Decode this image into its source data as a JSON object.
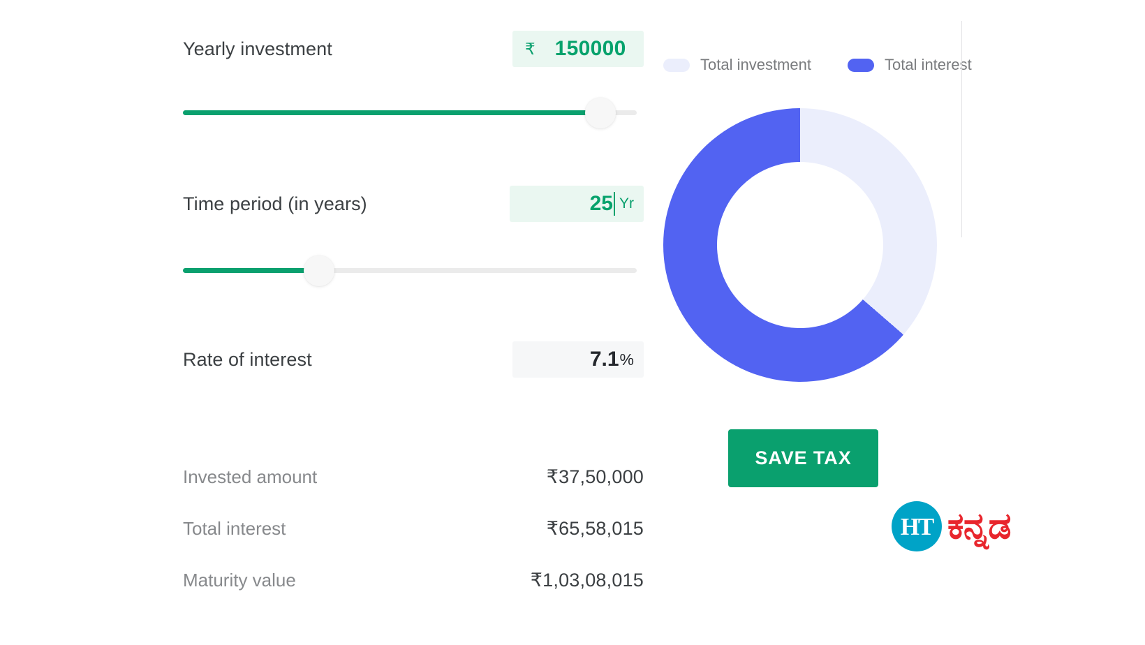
{
  "calculator": {
    "fields": [
      {
        "label": "Yearly investment",
        "currency_symbol": "₹",
        "value": "150000",
        "type": "money"
      },
      {
        "label": "Time period (in years)",
        "value": "25",
        "unit": "Yr",
        "type": "years"
      },
      {
        "label": "Rate of interest",
        "value": "7.1",
        "unit": "%",
        "type": "readonly"
      }
    ],
    "sliders": [
      {
        "name": "yearly-investment-slider",
        "fill_percent": 92
      },
      {
        "name": "time-period-slider",
        "fill_percent": 30
      }
    ],
    "results": [
      {
        "label": "Invested amount",
        "value": "₹37,50,000"
      },
      {
        "label": "Total interest",
        "value": "₹65,58,015"
      },
      {
        "label": "Maturity value",
        "value": "₹1,03,08,015"
      }
    ]
  },
  "chart_data": {
    "type": "pie",
    "title": "",
    "labels": [
      "Total investment",
      "Total interest"
    ],
    "values": [
      3750000,
      6558015
    ],
    "percentages": [
      36.4,
      63.6
    ],
    "colors": [
      "#ebeefc",
      "#5263f2"
    ],
    "legend_position": "top",
    "donut": true,
    "inner_radius_ratio": 0.607,
    "start_angle_deg": 0,
    "direction": "clockwise",
    "annotations": []
  },
  "actions": {
    "save_tax_label": "SAVE TAX"
  },
  "branding": {
    "mark_text": "HT",
    "word_text": "ಕನ್ನಡ",
    "mark_color": "#00a3c7",
    "word_color": "#e8262d"
  },
  "theme": {
    "accent_green": "#0aa06e",
    "chart_blue": "#5263f2",
    "chart_lavender": "#ebeefc",
    "field_green_bg": "#eaf7f1",
    "field_gray_bg": "#f6f7f8"
  }
}
